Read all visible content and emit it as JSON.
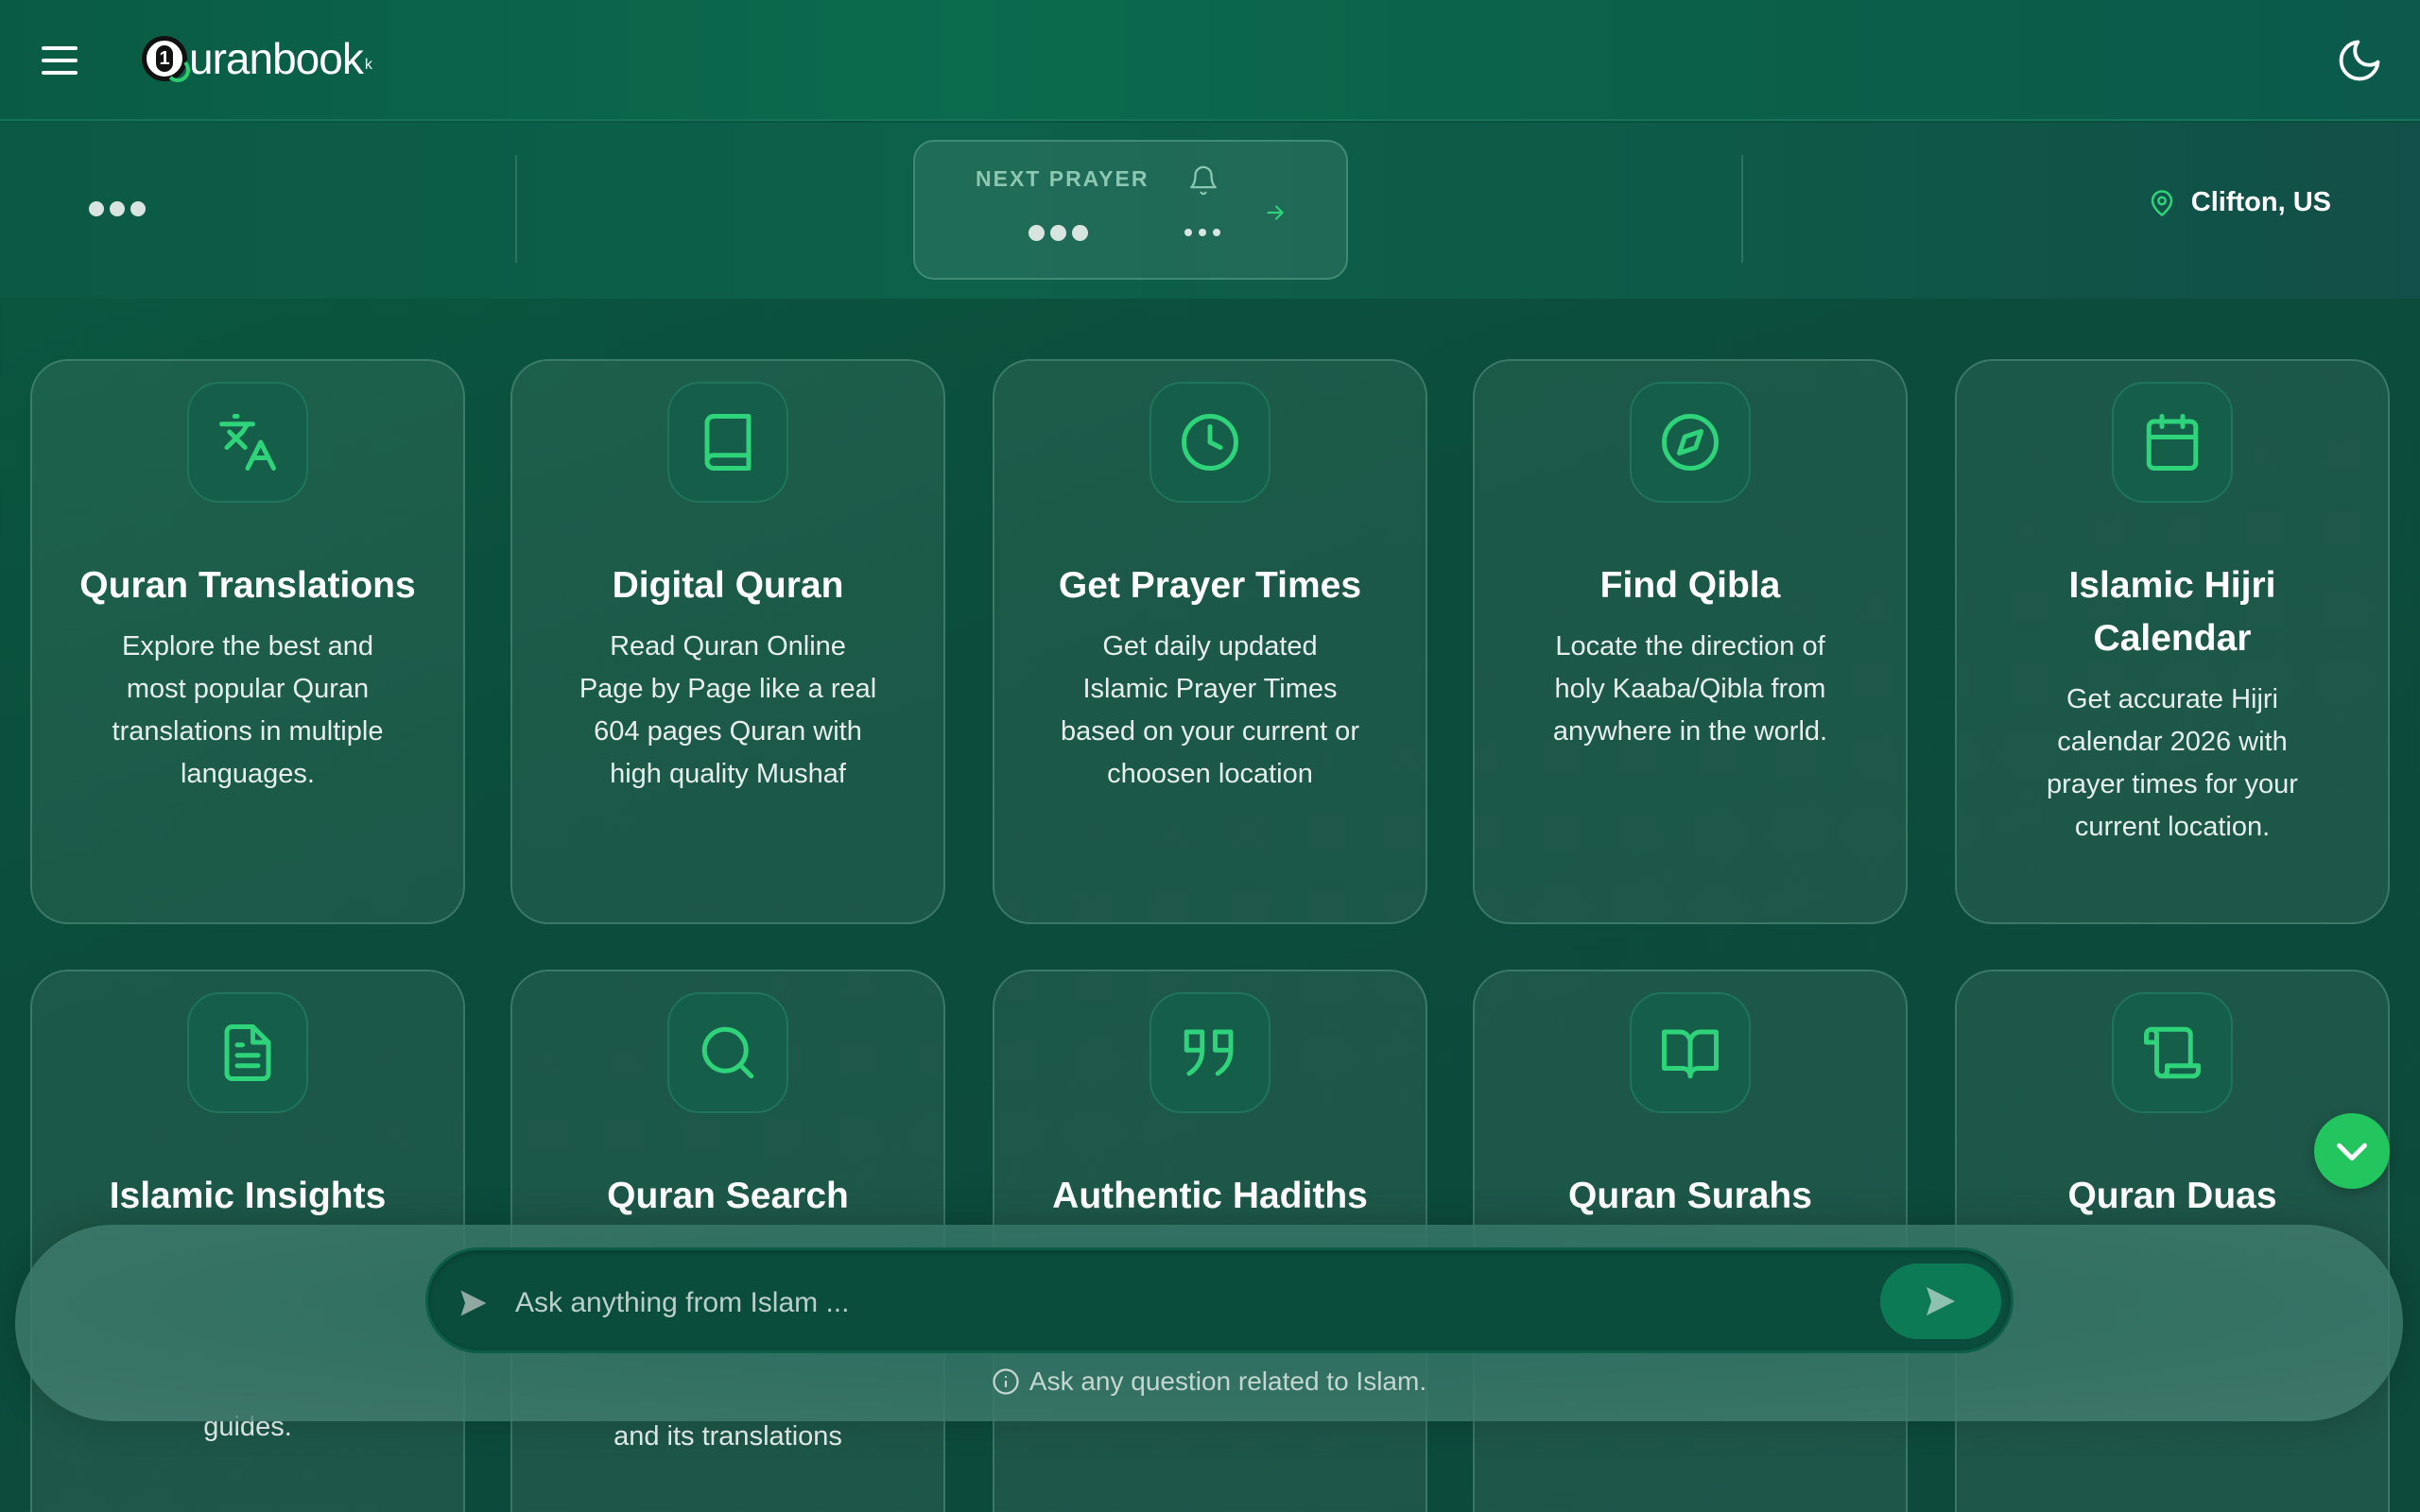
{
  "header": {
    "logo_text": "uranbook",
    "logo_mark_char": "1",
    "logo_sup": "k",
    "menu_icon": "hamburger-icon",
    "theme_icon": "moon-icon"
  },
  "prayer": {
    "next_label": "NEXT PRAYER",
    "location": "Clifton, US"
  },
  "cards_row1": [
    {
      "title": "Quran Translations",
      "desc": "Explore the best and most popular Quran translations in multiple languages.",
      "icon": "translate-icon"
    },
    {
      "title": "Digital Quran",
      "desc": "Read Quran Online Page by Page like a real 604 pages Quran with high quality Mushaf",
      "icon": "book-icon"
    },
    {
      "title": "Get Prayer Times",
      "desc": "Get daily updated Islamic Prayer Times based on your current or choosen location",
      "icon": "clock-icon"
    },
    {
      "title": "Find Qibla",
      "desc": "Locate the direction of holy Kaaba/Qibla from anywhere in the world.",
      "icon": "compass-icon"
    },
    {
      "title": "Islamic Hijri Calendar",
      "desc": "Get accurate Hijri calendar 2026 with prayer times for your current location.",
      "icon": "calendar-icon"
    }
  ],
  "cards_row2": [
    {
      "title": "Islamic Insights",
      "desc_tail": "guides.",
      "icon": "document-icon"
    },
    {
      "title": "Quran Search",
      "desc_tail": "and its translations",
      "icon": "search-icon"
    },
    {
      "title": "Authentic Hadiths",
      "icon": "quote-icon"
    },
    {
      "title": "Quran Surahs",
      "icon": "open-book-icon"
    },
    {
      "title": "Quran Duas",
      "icon": "scroll-icon"
    }
  ],
  "ask": {
    "placeholder": "Ask anything from Islam ...",
    "hint": "Ask any question related to Islam."
  },
  "colors": {
    "accent": "#22c55e",
    "icon_green": "#2fd37a",
    "background": "#0b4c3a"
  }
}
